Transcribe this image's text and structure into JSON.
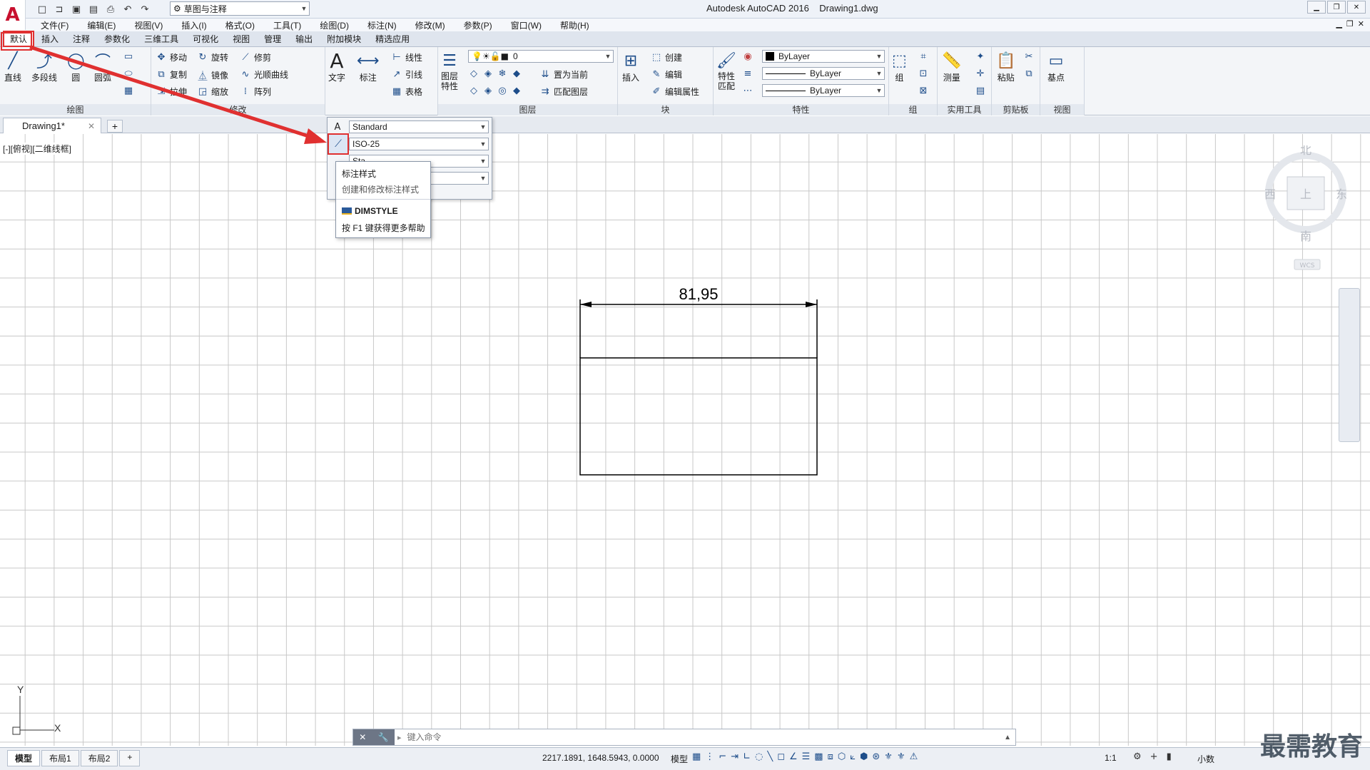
{
  "app": {
    "logo": "A",
    "title": "Autodesk AutoCAD 2016",
    "filename": "Drawing1.dwg",
    "workspace": "草图与注释"
  },
  "menu": [
    "文件(F)",
    "编辑(E)",
    "视图(V)",
    "插入(I)",
    "格式(O)",
    "工具(T)",
    "绘图(D)",
    "标注(N)",
    "修改(M)",
    "参数(P)",
    "窗口(W)",
    "帮助(H)"
  ],
  "ribbon_tabs": [
    "默认",
    "插入",
    "注释",
    "参数化",
    "三维工具",
    "可视化",
    "视图",
    "管理",
    "输出",
    "附加模块",
    "精选应用"
  ],
  "ribbon": {
    "draw": {
      "title": "绘图",
      "line": "直线",
      "polyline": "多段线",
      "circle": "圆",
      "arc": "圆弧"
    },
    "modify": {
      "title": "修改",
      "move": "移动",
      "rotate": "旋转",
      "trim": "修剪",
      "copy": "复制",
      "mirror": "镜像",
      "fillet": "光顺曲线",
      "stretch": "拉伸",
      "scale": "缩放",
      "array": "阵列"
    },
    "annotation": {
      "text": "文字",
      "dimension": "标注",
      "linear": "线性",
      "leader": "引线",
      "table": "表格"
    },
    "layers": {
      "title": "图层",
      "props": "图层\n特性",
      "current_layer": "0",
      "set_current": "置为当前",
      "match_layer": "匹配图层"
    },
    "block": {
      "title": "块",
      "insert": "插入",
      "create": "创建",
      "edit": "编辑",
      "edit_attr": "编辑属性"
    },
    "properties": {
      "title": "特性",
      "match": "特性\n匹配",
      "color": "ByLayer",
      "linetype": "ByLayer",
      "lineweight": "ByLayer"
    },
    "groups": {
      "title": "组",
      "group": "组"
    },
    "utilities": {
      "title": "实用工具",
      "measure": "测量"
    },
    "clipboard": {
      "title": "剪贴板",
      "paste": "粘贴"
    },
    "view": {
      "title": "视图",
      "base": "基点"
    }
  },
  "annotation_dropdown": {
    "text_style": "Standard",
    "dim_style": "ISO-25",
    "row3": "Sta",
    "row4": ""
  },
  "tooltip": {
    "title": "标注样式",
    "desc": "创建和修改标注样式",
    "command": "DIMSTYLE",
    "help": "按 F1 键获得更多帮助"
  },
  "doc_tab": "Drawing1*",
  "view_label": "[-][俯视][二维线框]",
  "viewcube": {
    "n": "北",
    "s": "南",
    "e": "东",
    "w": "西",
    "face": "上",
    "wcs": "WCS"
  },
  "drawing": {
    "dimension_value": "81,95"
  },
  "ucs": {
    "x": "X",
    "y": "Y"
  },
  "command_line": {
    "placeholder": "键入命令"
  },
  "layout_tabs": [
    "模型",
    "布局1",
    "布局2"
  ],
  "status": {
    "coords": "2217.1891, 1648.5943, 0.0000",
    "model": "模型",
    "scale": "1:1",
    "units": "小数"
  },
  "watermark": "最需教育",
  "colors": {
    "accent_red": "#e03030",
    "icon_blue": "#1d4d8a",
    "grid": "#c8c8c8"
  }
}
